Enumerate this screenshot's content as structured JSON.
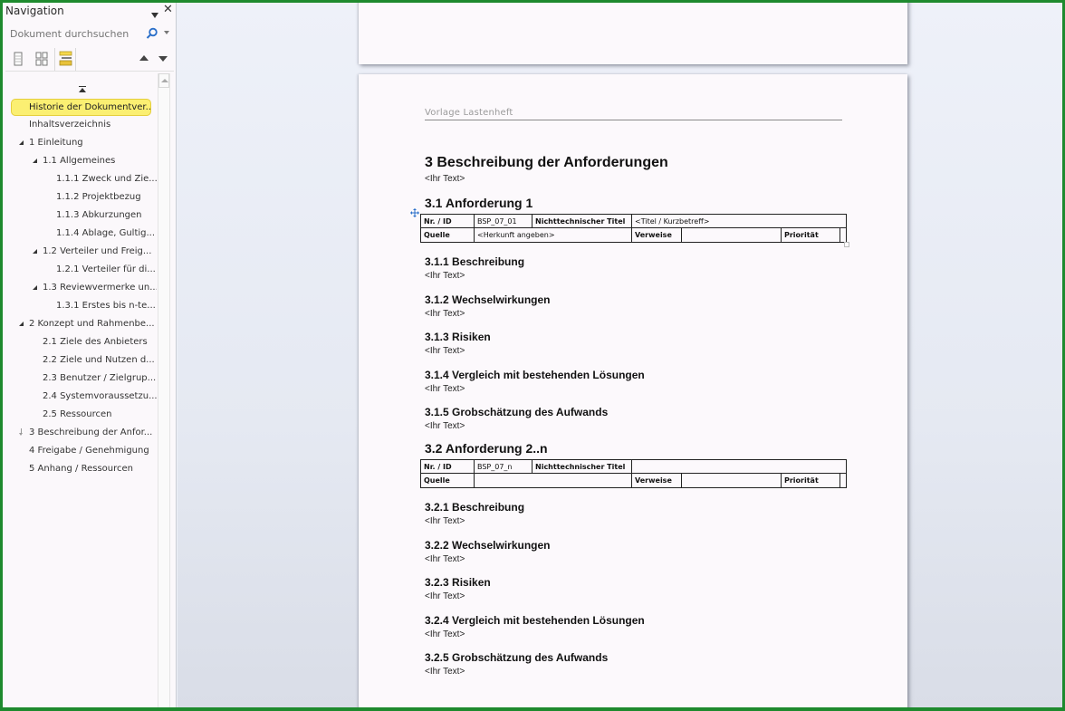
{
  "navigation": {
    "title": "Navigation",
    "search_placeholder": "Dokument durchsuchen",
    "search_value": "",
    "view_tabs": [
      {
        "name": "headings-view",
        "icon": "page-icon",
        "active": false
      },
      {
        "name": "pages-view",
        "icon": "thumbnails-icon",
        "active": false
      },
      {
        "name": "results-view",
        "icon": "headings-icon",
        "active": true
      }
    ],
    "tree": [
      {
        "label": "Historie der Dokumentver...",
        "level": 0,
        "toggle": "none",
        "selected": true
      },
      {
        "label": "Inhaltsverzeichnis",
        "level": 0,
        "toggle": "none"
      },
      {
        "label": "1 Einleitung",
        "level": 0,
        "toggle": "expanded"
      },
      {
        "label": "1.1 Allgemeines",
        "level": 1,
        "toggle": "expanded"
      },
      {
        "label": "1.1.1 Zweck und Zie...",
        "level": 2,
        "toggle": "none"
      },
      {
        "label": "1.1.2 Projektbezug",
        "level": 2,
        "toggle": "none"
      },
      {
        "label": "1.1.3 Abkurzungen",
        "level": 2,
        "toggle": "none"
      },
      {
        "label": "1.1.4 Ablage, Gultig...",
        "level": 2,
        "toggle": "none"
      },
      {
        "label": "1.2 Verteiler und Freig...",
        "level": 1,
        "toggle": "expanded"
      },
      {
        "label": "1.2.1 Verteiler für di...",
        "level": 2,
        "toggle": "none"
      },
      {
        "label": "1.3 Reviewvermerke un...",
        "level": 1,
        "toggle": "expanded"
      },
      {
        "label": "1.3.1 Erstes bis n-te...",
        "level": 2,
        "toggle": "none"
      },
      {
        "label": "2 Konzept und Rahmenbe...",
        "level": 0,
        "toggle": "expanded"
      },
      {
        "label": "2.1 Ziele des Anbieters",
        "level": 1,
        "toggle": "none"
      },
      {
        "label": "2.2 Ziele und Nutzen d...",
        "level": 1,
        "toggle": "none"
      },
      {
        "label": "2.3 Benutzer / Zielgrup...",
        "level": 1,
        "toggle": "none"
      },
      {
        "label": "2.4 Systemvoraussetzu...",
        "level": 1,
        "toggle": "none"
      },
      {
        "label": "2.5 Ressourcen",
        "level": 1,
        "toggle": "none"
      },
      {
        "label": "3 Beschreibung der Anfor...",
        "level": 0,
        "toggle": "collapsed"
      },
      {
        "label": "4 Freigabe / Genehmigung",
        "level": 0,
        "toggle": "none"
      },
      {
        "label": "5 Anhang / Ressourcen",
        "level": 0,
        "toggle": "none"
      }
    ]
  },
  "document": {
    "page_header": "Vorlage Lastenheft",
    "chapter": {
      "title": "3  Beschreibung  der Anforderungen",
      "text": "<Ihr Text>"
    },
    "requirements": [
      {
        "title": "3.1  Anforderung 1",
        "table": {
          "id_label": "Nr. / ID",
          "id_value": "BSP_07_01",
          "title_label": "Nichttechnischer Titel",
          "title_value": "<Titel / Kurzbetreff>",
          "source_label": "Quelle",
          "source_value": "<Herkunft angeben>",
          "refs_label": "Verweise",
          "refs_value": "",
          "priority_label": "Priorität",
          "priority_value": ""
        },
        "subsections": [
          {
            "title": "3.1.1  Beschreibung",
            "text": "<Ihr Text>"
          },
          {
            "title": "3.1.2  Wechselwirkungen",
            "text": "<Ihr Text>"
          },
          {
            "title": "3.1.3  Risiken",
            "text": "<Ihr Text>"
          },
          {
            "title": "3.1.4  Vergleich mit bestehenden Lösungen",
            "text": "<Ihr Text>"
          },
          {
            "title": "3.1.5  Grobschätzung des Aufwands",
            "text": "<Ihr Text>"
          }
        ]
      },
      {
        "title": "3.2  Anforderung 2..n",
        "table": {
          "id_label": "Nr. / ID",
          "id_value": "BSP_07_n",
          "title_label": "Nichttechnischer Titel",
          "title_value": "",
          "source_label": "Quelle",
          "source_value": "",
          "refs_label": "Verweise",
          "refs_value": "",
          "priority_label": "Priorität",
          "priority_value": ""
        },
        "subsections": [
          {
            "title": "3.2.1  Beschreibung",
            "text": "<Ihr Text>"
          },
          {
            "title": "3.2.2  Wechselwirkungen",
            "text": "<Ihr Text>"
          },
          {
            "title": "3.2.3  Risiken",
            "text": "<Ihr Text>"
          },
          {
            "title": "3.2.4  Vergleich mit bestehenden Lösungen",
            "text": "<Ihr Text>"
          },
          {
            "title": "3.2.5  Grobschätzung des Aufwands",
            "text": "<Ihr Text>"
          }
        ]
      }
    ]
  },
  "colors": {
    "window_border": "#1e8a2e",
    "selected_highlight": "#fbef72",
    "search_icon": "#2a6fc9"
  }
}
